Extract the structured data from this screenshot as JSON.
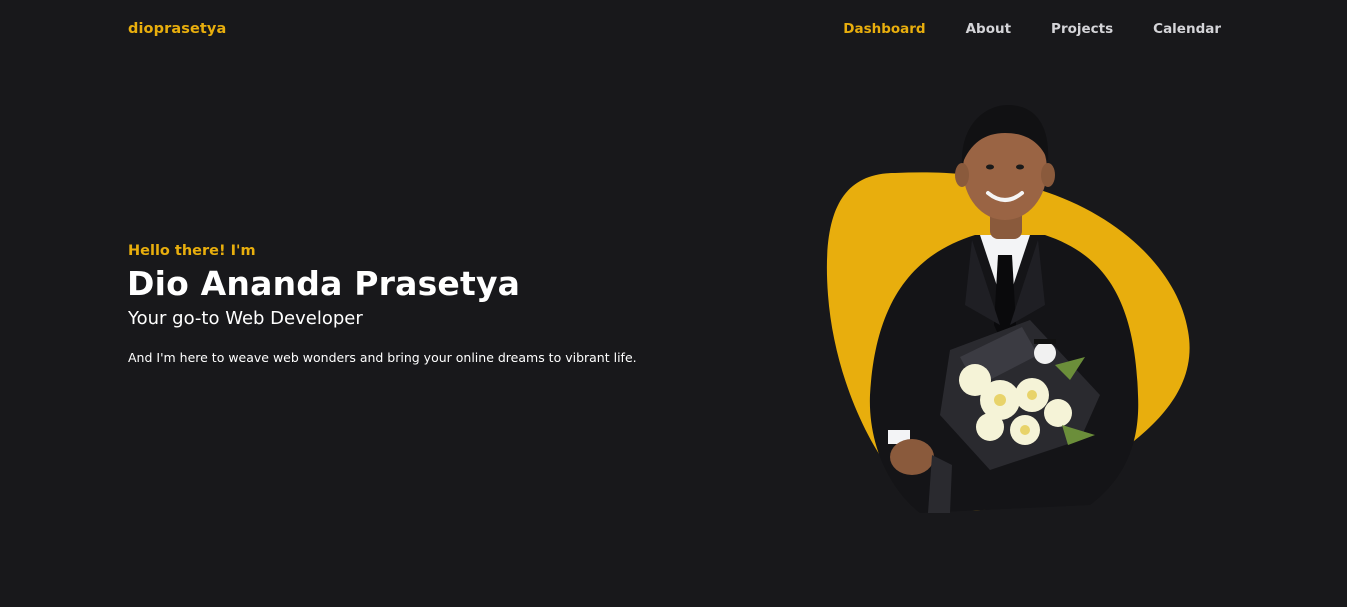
{
  "header": {
    "brand": "dioprasetya",
    "nav": [
      {
        "label": "Dashboard",
        "active": true
      },
      {
        "label": "About",
        "active": false
      },
      {
        "label": "Projects",
        "active": false
      },
      {
        "label": "Calendar",
        "active": false
      }
    ]
  },
  "hero": {
    "greeting": "Hello there! I'm",
    "name": "Dio Ananda Prasetya",
    "role": "Your go-to Web Developer",
    "description": "And I'm here to weave web wonders and bring your online dreams to vibrant life."
  },
  "colors": {
    "background": "#18181b",
    "accent": "#e8ae0d",
    "text": "#ffffff",
    "nav_text": "#d4d4d8"
  },
  "illustration": {
    "icon": "portrait-with-bouquet"
  }
}
